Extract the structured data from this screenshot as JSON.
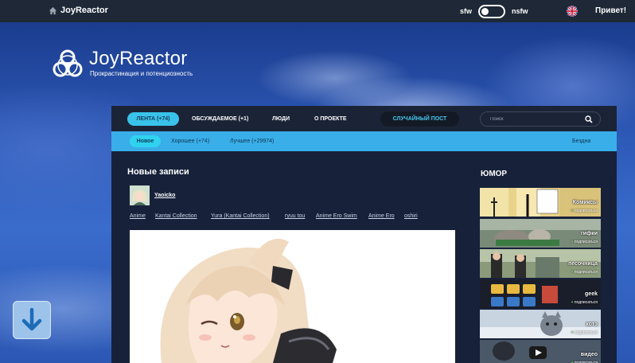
{
  "topbar": {
    "site_name": "JoyReactor",
    "sfw_label": "sfw",
    "nsfw_label": "nsfw",
    "greeting": "Привет!"
  },
  "logo": {
    "title": "JoyReactor",
    "subtitle": "Прокрастинация и потенциозность"
  },
  "nav": {
    "feed_label": "ЛЕНТА (+74)",
    "discussed_label": "ОБСУЖДАЕМОЕ (+1)",
    "people_label": "ЛЮДИ",
    "about_label": "О ПРОЕКТЕ",
    "random_label": "СЛУЧАЙНЫЙ ПОСТ",
    "search_placeholder": "Поиск"
  },
  "subnav": {
    "new_label": "Новое",
    "good_label": "Хорошее (+74)",
    "best_label": "Лучшее (+29974)",
    "abyss_label": "Бездна"
  },
  "main": {
    "section_title": "Новые записи",
    "post": {
      "author": "Yaoicko",
      "tags": [
        "Anime",
        "Kantai Collection",
        "Yura (Kantai Collection)",
        "ryuu tou",
        "Anime Ero Swim",
        "Anime Ero",
        "oshiri"
      ]
    }
  },
  "sidebar": {
    "title": "ЮМОР",
    "subscribe_label": "подписаться",
    "categories": [
      {
        "name": "Комиксы"
      },
      {
        "name": "гифки"
      },
      {
        "name": "песочница"
      },
      {
        "name": "geek"
      },
      {
        "name": "котэ"
      },
      {
        "name": "видео"
      }
    ]
  }
}
